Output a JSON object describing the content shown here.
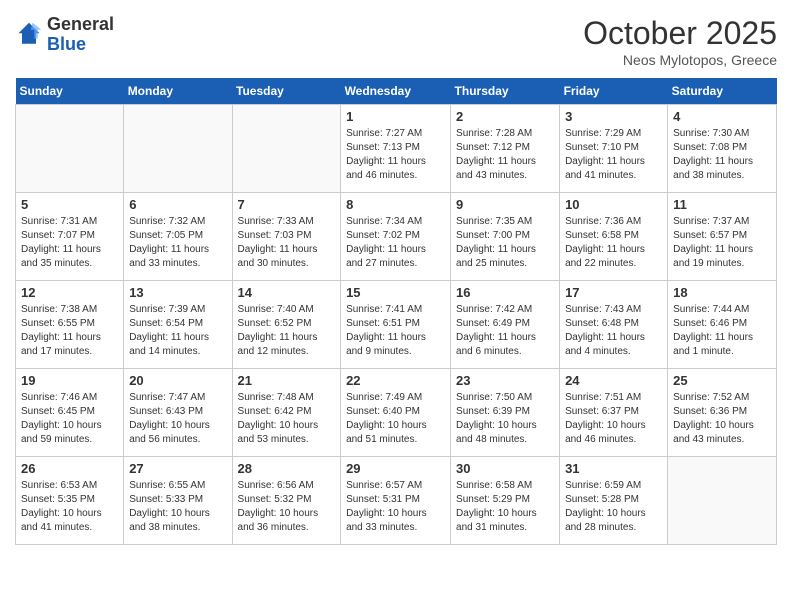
{
  "header": {
    "logo_line1": "General",
    "logo_line2": "Blue",
    "month": "October 2025",
    "location": "Neos Mylotopos, Greece"
  },
  "weekdays": [
    "Sunday",
    "Monday",
    "Tuesday",
    "Wednesday",
    "Thursday",
    "Friday",
    "Saturday"
  ],
  "weeks": [
    [
      {
        "day": "",
        "sunrise": "",
        "sunset": "",
        "daylight": ""
      },
      {
        "day": "",
        "sunrise": "",
        "sunset": "",
        "daylight": ""
      },
      {
        "day": "",
        "sunrise": "",
        "sunset": "",
        "daylight": ""
      },
      {
        "day": "1",
        "sunrise": "7:27 AM",
        "sunset": "7:13 PM",
        "daylight": "11 hours and 46 minutes."
      },
      {
        "day": "2",
        "sunrise": "7:28 AM",
        "sunset": "7:12 PM",
        "daylight": "11 hours and 43 minutes."
      },
      {
        "day": "3",
        "sunrise": "7:29 AM",
        "sunset": "7:10 PM",
        "daylight": "11 hours and 41 minutes."
      },
      {
        "day": "4",
        "sunrise": "7:30 AM",
        "sunset": "7:08 PM",
        "daylight": "11 hours and 38 minutes."
      }
    ],
    [
      {
        "day": "5",
        "sunrise": "7:31 AM",
        "sunset": "7:07 PM",
        "daylight": "11 hours and 35 minutes."
      },
      {
        "day": "6",
        "sunrise": "7:32 AM",
        "sunset": "7:05 PM",
        "daylight": "11 hours and 33 minutes."
      },
      {
        "day": "7",
        "sunrise": "7:33 AM",
        "sunset": "7:03 PM",
        "daylight": "11 hours and 30 minutes."
      },
      {
        "day": "8",
        "sunrise": "7:34 AM",
        "sunset": "7:02 PM",
        "daylight": "11 hours and 27 minutes."
      },
      {
        "day": "9",
        "sunrise": "7:35 AM",
        "sunset": "7:00 PM",
        "daylight": "11 hours and 25 minutes."
      },
      {
        "day": "10",
        "sunrise": "7:36 AM",
        "sunset": "6:58 PM",
        "daylight": "11 hours and 22 minutes."
      },
      {
        "day": "11",
        "sunrise": "7:37 AM",
        "sunset": "6:57 PM",
        "daylight": "11 hours and 19 minutes."
      }
    ],
    [
      {
        "day": "12",
        "sunrise": "7:38 AM",
        "sunset": "6:55 PM",
        "daylight": "11 hours and 17 minutes."
      },
      {
        "day": "13",
        "sunrise": "7:39 AM",
        "sunset": "6:54 PM",
        "daylight": "11 hours and 14 minutes."
      },
      {
        "day": "14",
        "sunrise": "7:40 AM",
        "sunset": "6:52 PM",
        "daylight": "11 hours and 12 minutes."
      },
      {
        "day": "15",
        "sunrise": "7:41 AM",
        "sunset": "6:51 PM",
        "daylight": "11 hours and 9 minutes."
      },
      {
        "day": "16",
        "sunrise": "7:42 AM",
        "sunset": "6:49 PM",
        "daylight": "11 hours and 6 minutes."
      },
      {
        "day": "17",
        "sunrise": "7:43 AM",
        "sunset": "6:48 PM",
        "daylight": "11 hours and 4 minutes."
      },
      {
        "day": "18",
        "sunrise": "7:44 AM",
        "sunset": "6:46 PM",
        "daylight": "11 hours and 1 minute."
      }
    ],
    [
      {
        "day": "19",
        "sunrise": "7:46 AM",
        "sunset": "6:45 PM",
        "daylight": "10 hours and 59 minutes."
      },
      {
        "day": "20",
        "sunrise": "7:47 AM",
        "sunset": "6:43 PM",
        "daylight": "10 hours and 56 minutes."
      },
      {
        "day": "21",
        "sunrise": "7:48 AM",
        "sunset": "6:42 PM",
        "daylight": "10 hours and 53 minutes."
      },
      {
        "day": "22",
        "sunrise": "7:49 AM",
        "sunset": "6:40 PM",
        "daylight": "10 hours and 51 minutes."
      },
      {
        "day": "23",
        "sunrise": "7:50 AM",
        "sunset": "6:39 PM",
        "daylight": "10 hours and 48 minutes."
      },
      {
        "day": "24",
        "sunrise": "7:51 AM",
        "sunset": "6:37 PM",
        "daylight": "10 hours and 46 minutes."
      },
      {
        "day": "25",
        "sunrise": "7:52 AM",
        "sunset": "6:36 PM",
        "daylight": "10 hours and 43 minutes."
      }
    ],
    [
      {
        "day": "26",
        "sunrise": "6:53 AM",
        "sunset": "5:35 PM",
        "daylight": "10 hours and 41 minutes."
      },
      {
        "day": "27",
        "sunrise": "6:55 AM",
        "sunset": "5:33 PM",
        "daylight": "10 hours and 38 minutes."
      },
      {
        "day": "28",
        "sunrise": "6:56 AM",
        "sunset": "5:32 PM",
        "daylight": "10 hours and 36 minutes."
      },
      {
        "day": "29",
        "sunrise": "6:57 AM",
        "sunset": "5:31 PM",
        "daylight": "10 hours and 33 minutes."
      },
      {
        "day": "30",
        "sunrise": "6:58 AM",
        "sunset": "5:29 PM",
        "daylight": "10 hours and 31 minutes."
      },
      {
        "day": "31",
        "sunrise": "6:59 AM",
        "sunset": "5:28 PM",
        "daylight": "10 hours and 28 minutes."
      },
      {
        "day": "",
        "sunrise": "",
        "sunset": "",
        "daylight": ""
      }
    ]
  ]
}
